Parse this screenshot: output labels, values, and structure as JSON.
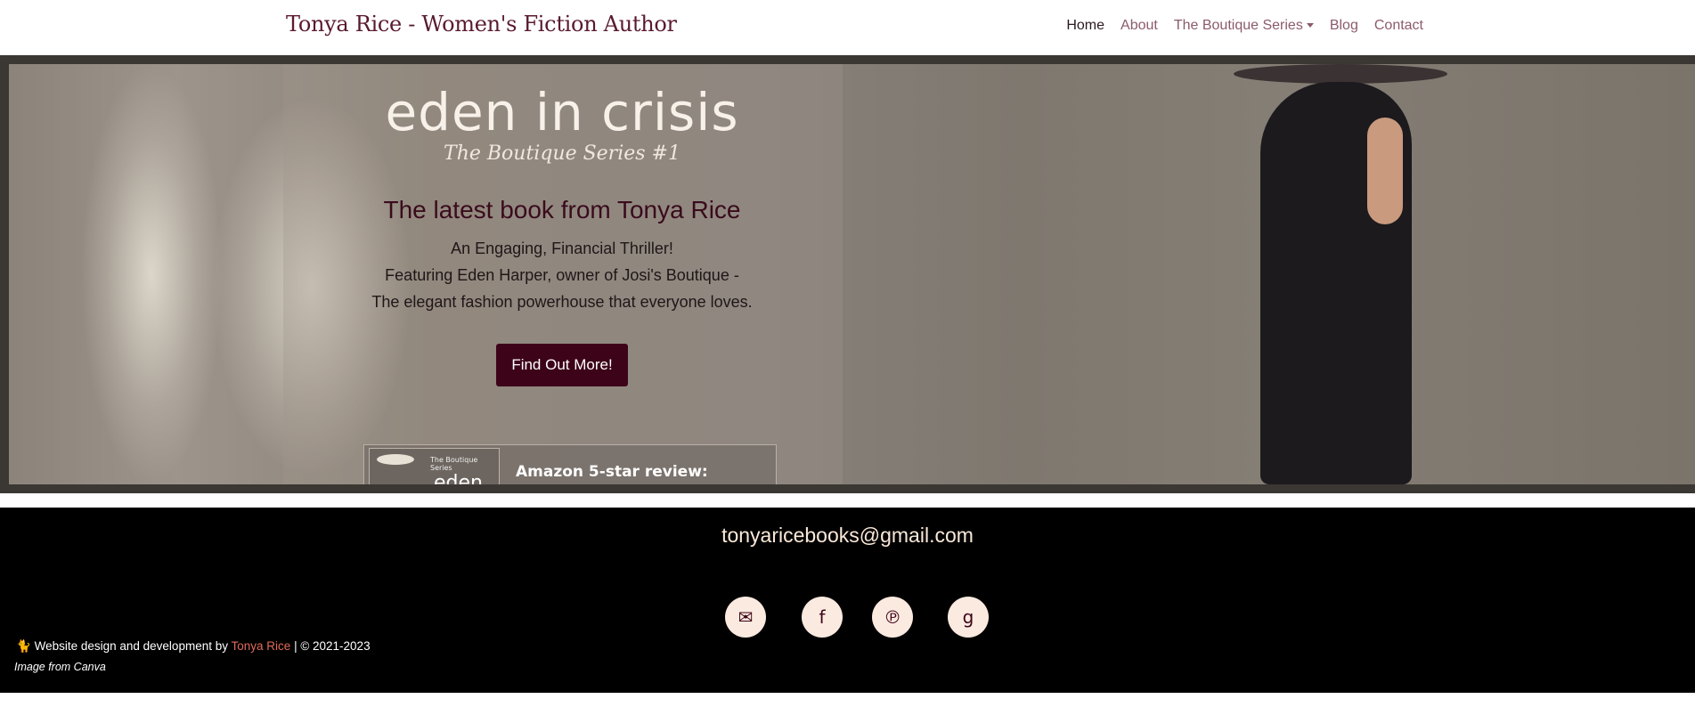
{
  "navbar": {
    "brand": "Tonya Rice - Women's Fiction Author",
    "items": [
      {
        "label": "Home"
      },
      {
        "label": "About"
      },
      {
        "label": "The Boutique Series"
      },
      {
        "label": "Blog"
      },
      {
        "label": "Contact"
      }
    ]
  },
  "hero": {
    "title": "eden in crisis",
    "subtitle": "The Boutique Series #1",
    "headline": "The latest book from Tonya Rice",
    "desc_line1": "An Engaging, Financial Thriller!",
    "desc_line2": "Featuring Eden Harper, owner of Josi's Boutique -",
    "desc_line3": "The elegant fashion powerhouse that everyone loves.",
    "cta_label": "Find Out More!",
    "review_label": "Amazon 5-star review:",
    "cover_series": "The Boutique Series",
    "cover_title": "eden"
  },
  "footer": {
    "email": "tonyaricebooks@gmail.com",
    "social": [
      {
        "icon": "mail-icon",
        "glyph": "✉"
      },
      {
        "icon": "facebook-icon",
        "glyph": "f"
      },
      {
        "icon": "pinterest-icon",
        "glyph": "℗"
      },
      {
        "icon": "goodreads-icon",
        "glyph": "g"
      }
    ],
    "credits_prefix": "Website design and development by",
    "credits_link": "Tonya Rice",
    "credits_suffix": "| © 2021-2023",
    "note": "Image from Canva"
  }
}
